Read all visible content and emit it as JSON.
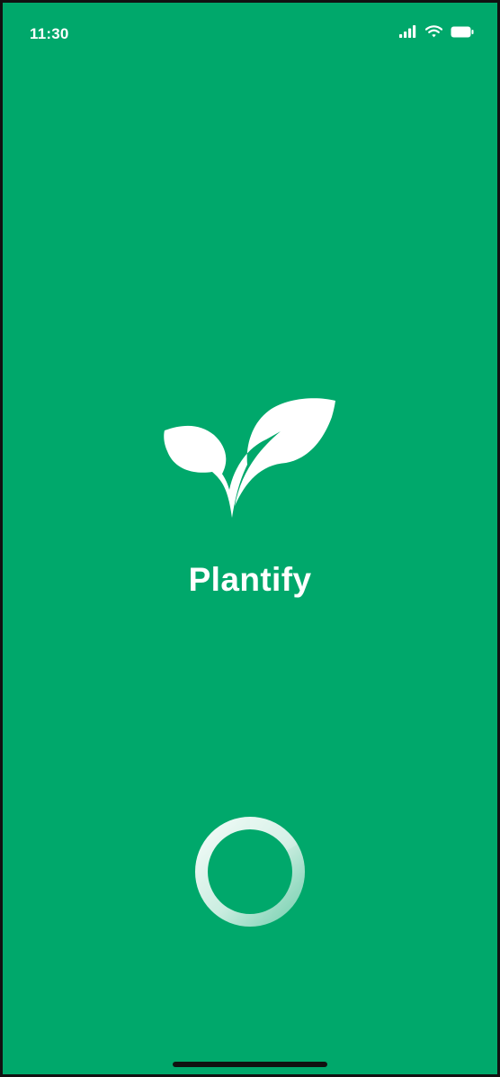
{
  "status_bar": {
    "time": "11:30",
    "icons": [
      "cellular-signal-icon",
      "wifi-icon",
      "battery-icon"
    ]
  },
  "splash": {
    "logo_icon": "plant-sprout-icon",
    "app_name": "Plantify"
  },
  "loader": {
    "icon": "loading-spinner-icon"
  },
  "colors": {
    "background": "#00A86B",
    "foreground": "#FFFFFF",
    "frame": "#111111"
  }
}
